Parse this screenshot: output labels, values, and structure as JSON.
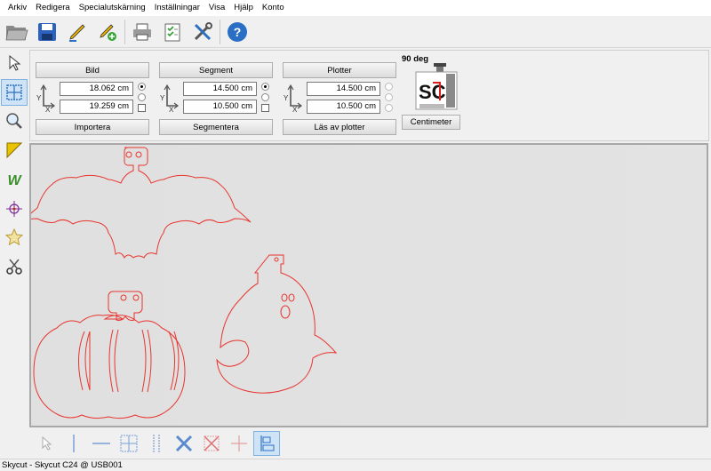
{
  "menu": [
    "Arkiv",
    "Redigera",
    "Specialutskärning",
    "Inställningar",
    "Visa",
    "Hjälp",
    "Konto"
  ],
  "toolbar_icons": [
    "open-folder-icon",
    "save-icon",
    "pen-edit-icon",
    "pen-add-icon",
    "printer-icon",
    "checklist-icon",
    "tools-icon",
    "help-icon"
  ],
  "left_tools": [
    "pointer-icon",
    "select-area-icon",
    "zoom-icon",
    "ruler-icon",
    "weed-icon",
    "crosshair-icon",
    "star-icon",
    "scissors-icon"
  ],
  "bild": {
    "header": "Bild",
    "x_value": "18.062 cm",
    "y_value": "19.259 cm",
    "footer": "Importera"
  },
  "segment": {
    "header": "Segment",
    "x_value": "14.500 cm",
    "y_value": "10.500 cm",
    "footer": "Segmentera"
  },
  "plotter": {
    "header": "Plotter",
    "x_value": "14.500 cm",
    "y_value": "10.500 cm",
    "footer": "Läs av plotter"
  },
  "axis": {
    "x": "X",
    "y": "Y"
  },
  "orientation": "90 deg",
  "unit_button": "Centimeter",
  "device_logo": "SC",
  "bottom_tools": [
    "pointer-icon",
    "vertical-line-icon",
    "horizontal-line-icon",
    "box-icon",
    "double-vertical-icon",
    "delete-x-icon",
    "delete-box-icon",
    "crosshair-line-icon",
    "align-icon"
  ],
  "status": "Skycut - Skycut C24 @ USB001",
  "colors": {
    "cut_line": "#e8352f",
    "accent": "#2a6fc4"
  }
}
